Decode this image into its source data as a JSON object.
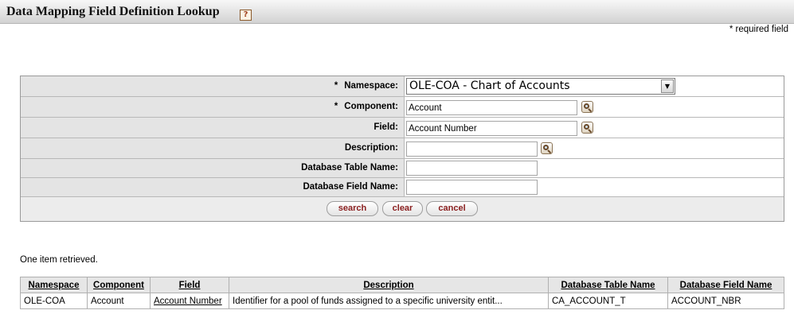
{
  "page": {
    "title": "Data Mapping Field Definition Lookup",
    "help_icon": "?",
    "required_note": "* required field"
  },
  "form": {
    "namespace": {
      "required_mark": "*",
      "label": "Namespace:",
      "value": "OLE-COA - Chart of Accounts"
    },
    "component": {
      "required_mark": "*",
      "label": "Component:",
      "value": "Account"
    },
    "field": {
      "label": "Field:",
      "value": "Account Number"
    },
    "description": {
      "label": "Description:",
      "value": ""
    },
    "db_table_name": {
      "label": "Database Table Name:",
      "value": ""
    },
    "db_field_name": {
      "label": "Database Field Name:",
      "value": ""
    },
    "buttons": {
      "search": "search",
      "clear": "clear",
      "cancel": "cancel"
    }
  },
  "results": {
    "count_text": "One item retrieved.",
    "columns": [
      "Namespace",
      "Component",
      "Field",
      "Description",
      "Database Table Name",
      "Database Field Name"
    ],
    "rows": [
      [
        "OLE-COA",
        "Account",
        "Account Number",
        "Identifier for a pool of funds assigned to a specific university entit...",
        "CA_ACCOUNT_T",
        "ACCOUNT_NBR"
      ]
    ]
  },
  "icons": {
    "select_arrow": "▼",
    "lookup": "magnifier-icon"
  }
}
